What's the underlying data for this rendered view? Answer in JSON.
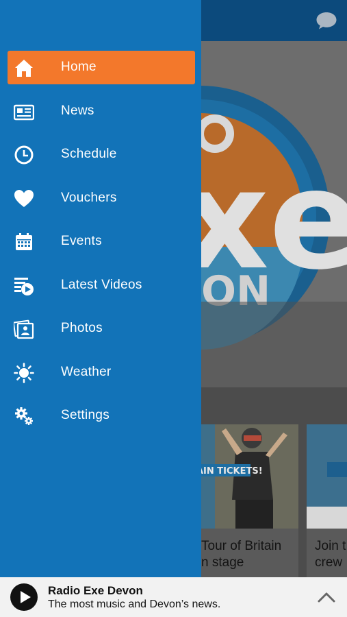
{
  "menu": {
    "items": [
      {
        "label": "Home",
        "icon": "home-icon",
        "active": true
      },
      {
        "label": "News",
        "icon": "news-icon",
        "active": false
      },
      {
        "label": "Schedule",
        "icon": "clock-icon",
        "active": false
      },
      {
        "label": "Vouchers",
        "icon": "heart-icon",
        "active": false
      },
      {
        "label": "Events",
        "icon": "calendar-icon",
        "active": false
      },
      {
        "label": "Latest Videos",
        "icon": "video-list-icon",
        "active": false
      },
      {
        "label": "Photos",
        "icon": "photos-icon",
        "active": false
      },
      {
        "label": "Weather",
        "icon": "sun-icon",
        "active": false
      },
      {
        "label": "Settings",
        "icon": "gears-icon",
        "active": false
      }
    ]
  },
  "background": {
    "card1": {
      "title_line1": "Tour of Britain",
      "title_line2": "n stage",
      "banner": "AIN TICKETS!"
    },
    "card2": {
      "title_line1": "Join t",
      "title_line2": "crew"
    }
  },
  "player": {
    "station": "Radio Exe Devon",
    "tagline": "The most music and Devon’s news."
  },
  "colors": {
    "drawer": "#1273b8",
    "active_item": "#f3782b",
    "topbar": "#0c4a7c"
  }
}
